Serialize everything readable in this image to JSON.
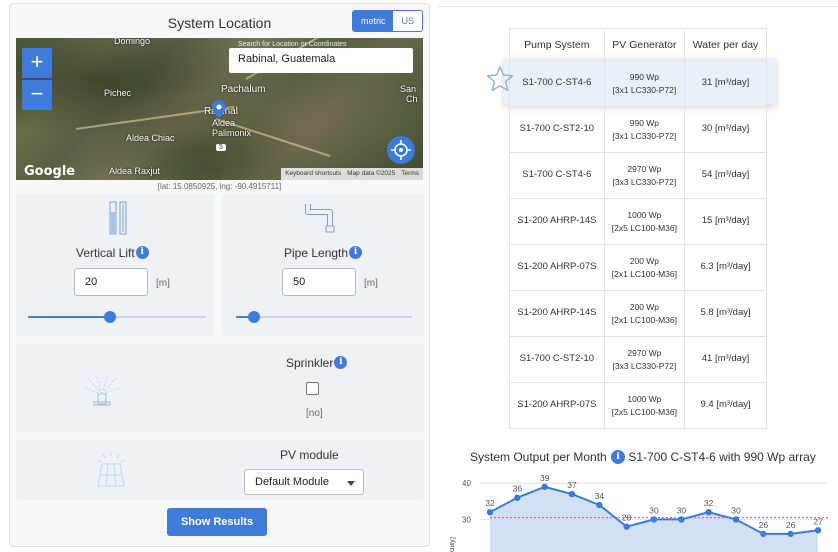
{
  "location": {
    "title": "System Location",
    "units": {
      "metric": "metric",
      "us": "US"
    },
    "map": {
      "search_placeholder": "Search for Location or Coordinates",
      "search_value": "Rabinal, Guatemala",
      "zoom_in": "+",
      "zoom_out": "−",
      "labels": {
        "domingo": "Domingo",
        "pichec": "Pichec",
        "pachalum": "Pachalum",
        "rabinal": "Rabinal",
        "aldea": "Aldea",
        "palimonix": "Palimonix",
        "aldea_chiac": "Aldea Chiac",
        "aldea_raxjut": "Aldea Raxjut",
        "san": "San",
        "ch": "Ch",
        "route": "5"
      },
      "google": "Google",
      "attr": {
        "shortcuts": "Keyboard shortcuts",
        "data": "Map data ©2025",
        "terms": "Terms"
      }
    },
    "coords": "[lat: 15.0850925, lng: -90.4915711]"
  },
  "vertical_lift": {
    "label": "Vertical Lift",
    "value": "20",
    "unit": "[m]",
    "slider": 0.46
  },
  "pipe_length": {
    "label": "Pipe Length",
    "value": "50",
    "unit": "[m]",
    "slider": 0.1
  },
  "sprinkler": {
    "label": "Sprinkler",
    "state": "[no]"
  },
  "pv_module": {
    "label": "PV module",
    "selected": "Default Module"
  },
  "show_results": "Show Results",
  "info_glyph": "i",
  "table": {
    "headers": [
      "Pump System",
      "PV Generator",
      "Water per day"
    ],
    "rows": [
      {
        "pump": "S1-700 C-ST4-6",
        "gen1": "990 Wp",
        "gen2": "[3x1 LC330-P72]",
        "water": "31 [m³/day]"
      },
      {
        "pump": "S1-700 C-ST2-10",
        "gen1": "990 Wp",
        "gen2": "[3x1 LC330-P72]",
        "water": "30 [m³/day]"
      },
      {
        "pump": "S1-700 C-ST4-6",
        "gen1": "2970 Wp",
        "gen2": "[3x3 LC330-P72]",
        "water": "54 [m³/day]"
      },
      {
        "pump": "S1-200 AHRP-14S",
        "gen1": "1000 Wp",
        "gen2": "[2x5 LC100-M36]",
        "water": "15 [m³/day]"
      },
      {
        "pump": "S1-200 AHRP-07S",
        "gen1": "200 Wp",
        "gen2": "[2x1 LC100-M36]",
        "water": "6.3 [m³/day]"
      },
      {
        "pump": "S1-200 AHRP-14S",
        "gen1": "200 Wp",
        "gen2": "[2x1 LC100-M36]",
        "water": "5.8 [m³/day]"
      },
      {
        "pump": "S1-700 C-ST2-10",
        "gen1": "2970 Wp",
        "gen2": "[3x3 LC330-P72]",
        "water": "41 [m³/day]"
      },
      {
        "pump": "S1-200 AHRP-07S",
        "gen1": "1000 Wp",
        "gen2": "[2x5 LC100-M36]",
        "water": "9.4 [m³/day]"
      }
    ]
  },
  "chart_title": {
    "prefix": "System Output per Month",
    "suffix": "S1-700 C-ST4-6 with 990 Wp array"
  },
  "chart_data": {
    "type": "area",
    "values": [
      32,
      36,
      39,
      37,
      34,
      28,
      30,
      30,
      32,
      30,
      26,
      26,
      27
    ],
    "yticks": [
      30,
      40
    ],
    "ylabel": "day]",
    "ylim": [
      21,
      42
    ],
    "reference_line": 30.5,
    "colors": {
      "line": "#3f7bd8",
      "fill": "#c9dbf1",
      "reference": "#e040c0"
    }
  },
  "colors": {
    "accent": "#3f7bd8",
    "highlight_row": "#e8f0f8"
  }
}
